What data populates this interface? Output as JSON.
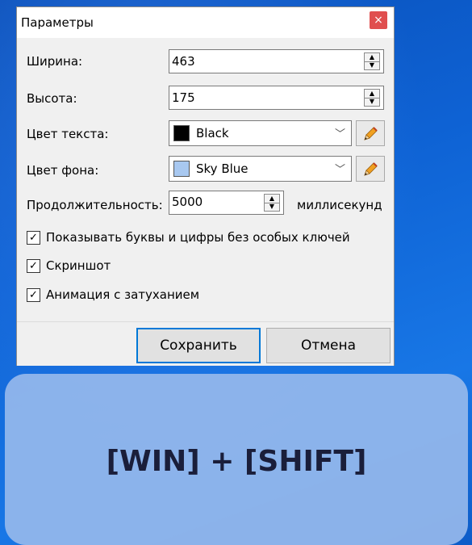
{
  "window": {
    "title": "Параметры",
    "close_icon": "close-icon",
    "close_glyph": "×"
  },
  "fields": {
    "width": {
      "label": "Ширина:",
      "value": "463"
    },
    "height": {
      "label": "Высота:",
      "value": "175"
    },
    "text_color": {
      "label": "Цвет текста:",
      "value": "Black",
      "swatch": "#000000"
    },
    "bg_color": {
      "label": "Цвет фона:",
      "value": "Sky Blue",
      "swatch": "#a8c8f0"
    },
    "duration": {
      "label": "Продолжительность:",
      "value": "5000",
      "unit": "миллисекунд"
    }
  },
  "icons": {
    "spin_up": "▲",
    "spin_down": "▼",
    "chevron": "﹀",
    "pencil": "pencil-icon"
  },
  "checkboxes": [
    {
      "label": "Показывать буквы и цифры без особых ключей",
      "checked": true
    },
    {
      "label": "Скриншот",
      "checked": true
    },
    {
      "label": "Анимация с затуханием",
      "checked": true
    }
  ],
  "checkmark": "✓",
  "buttons": {
    "save": "Сохранить",
    "cancel": "Отмена"
  },
  "overlay": {
    "text": "[WIN] + [SHIFT]"
  },
  "colors": {
    "accent": "#0078d7",
    "close": "#e04f4f",
    "overlay_bg": "#96b9eb",
    "overlay_text": "#1a1e3a"
  }
}
